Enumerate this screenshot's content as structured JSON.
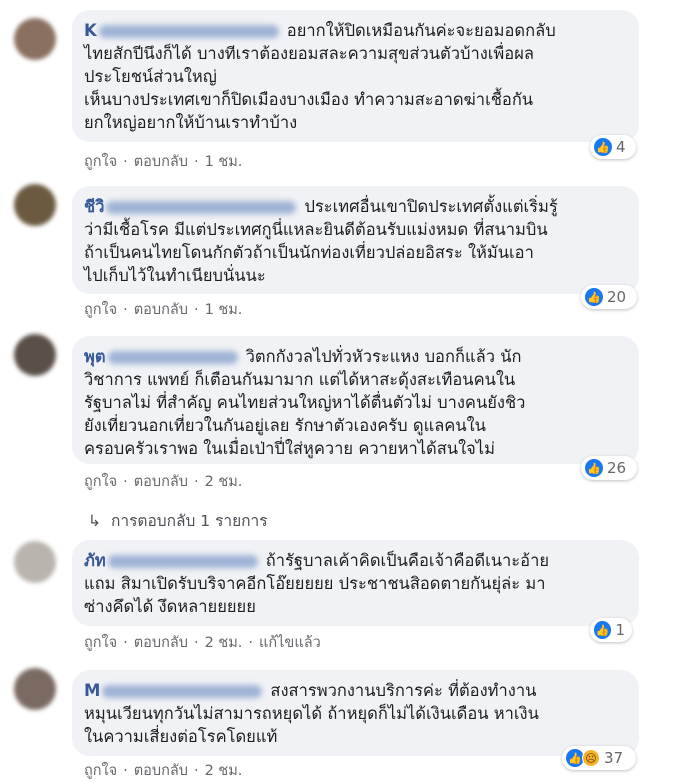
{
  "comments": [
    {
      "name": "K",
      "lines": [
        "อยากให้ปิดเหมือนกันค่ะจะยอมอดกลับ",
        "ไทยสักปีนึงก็ได้ บางทีเราต้องยอมสละความสุขส่วนตัวบ้างเพื่อผล",
        "ประโยชน์ส่วนใหญ่",
        "เห็นบางประเทศเขาก็ปิดเมืองบางเมือง ทำความสะอาดฆ่าเชื้อกัน",
        "ยกใหญ่อยากให้บ้านเราทำบ้าง"
      ],
      "reaction_count": "4",
      "like": "ถูกใจ",
      "reply": "ตอบกลับ",
      "time": "1 ชม.",
      "avatar_color": "#8a7060"
    },
    {
      "name": "ชีวิ",
      "lines": [
        "ประเทศอื่นเขาปิดประเทศตั้งแต่เริ่มรู้",
        "ว่ามีเชื้อโรค มีแต่ประเทศกูนี่แหละยินดีต้อนรับแม่งหมด ที่สนามบิน",
        "ถ้าเป็นคนไทยโดนกักตัวถ้าเป็นนักท่องเที่ยวปล่อยอิสระ ให้มันเอา",
        "ไปเก็บไว้ในทำเนียบนั่นนะ"
      ],
      "reaction_count": "20",
      "like": "ถูกใจ",
      "reply": "ตอบกลับ",
      "time": "1 ชม.",
      "avatar_color": "#6b5a40"
    },
    {
      "name": "พุต",
      "lines": [
        "วิตกกังวลไปทั่วหัวระแหง บอกก็แล้ว นัก",
        "วิชาการ แพทย์ ก็เตือนกันมามาก แต่ได้หาสะดุ้งสะเทือนคนใน",
        "รัฐบาลไม่ ที่สำคัญ คนไทยส่วนใหญ่หาได้ตื่นตัวไม่ บางคนยังชิว",
        "ยังเที่ยวนอกเที่ยวในกันอยู่เลย รักษาตัวเองครับ ดูแลคนใน",
        "ครอบครัวเราพอ ในเมื่อเป่าปี่ใส่หูควาย ควายหาได้สนใจไม่"
      ],
      "reaction_count": "26",
      "like": "ถูกใจ",
      "reply": "ตอบกลับ",
      "time": "2 ชม.",
      "avatar_color": "#5b5048"
    },
    {
      "name": "ภัท",
      "lines": [
        "ถ้ารัฐบาลเค้าคิดเป็นคือเจ้าคือดีเนาะอ้าย",
        "แถม สิมาเปิดรับบริจาคอีกโอ๊ยยยยย ประชาชนสิอดตายกันยุ่ล่ะ มา",
        "ซ่างคึดได้ งึดหลายยยยย"
      ],
      "reaction_count": "1",
      "like": "ถูกใจ",
      "reply": "ตอบกลับ",
      "time": "2 ชม.",
      "edited": "แก้ไขแล้ว",
      "avatar_color": "#b9b4ae"
    },
    {
      "name": "M",
      "lines": [
        "สงสารพวกงานบริการค่ะ ที่ต้องทำงาน",
        "หมุนเวียนทุกวันไม่สามารถหยุดได้ ถ้าหยุดก็ไม่ได้เงินเดือน หาเงิน",
        "ในความเสี่ยงต่อโรคโดยแท้"
      ],
      "reaction_count": "37",
      "like": "ถูกใจ",
      "reply": "ตอบกลับ",
      "time": "2 ชม.",
      "avatar_color": "#7a6a62"
    }
  ],
  "replies_link": "การตอบกลับ 1 รายการ",
  "colors": {
    "bubble": "#f0f2f5",
    "name": "#385898",
    "meta": "#65676b",
    "like_blue": "#1877f2",
    "sad_yellow": "#f7b125"
  },
  "icons": {
    "like": "like-icon",
    "sad": "sad-icon",
    "reply_arrow": "reply-arrow-icon"
  }
}
